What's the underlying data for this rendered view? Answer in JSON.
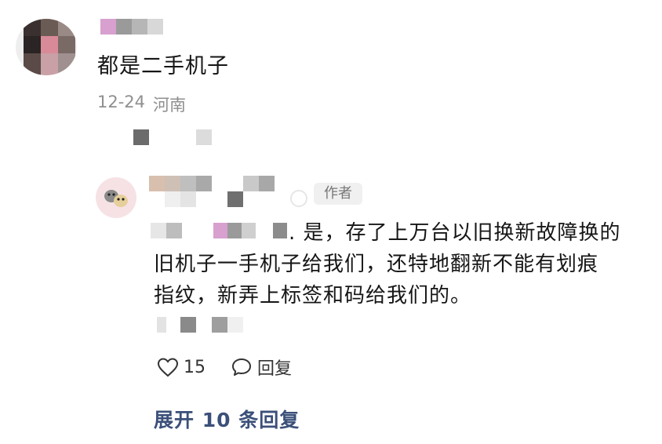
{
  "comment": {
    "text": "都是二手机子",
    "date": "12-24",
    "location": "河南"
  },
  "reply": {
    "badge": "作者",
    "line1_visible": ". 是，存了上万台以旧换新故障换的",
    "line2_visible": "旧机子一手机子给我们，还特地翻新不能有划痕",
    "line3": "指纹，新弄上标签和码给我们的。"
  },
  "actions": {
    "like_icon": "heart-icon",
    "like_count": "15",
    "reply_icon": "comment-bubble-icon",
    "reply_label": "回复"
  },
  "expand_label": "展开 10 条回复",
  "colors": {
    "link": "#3b5079",
    "meta": "#8f8f8f",
    "badge_bg": "#f0f0f0"
  }
}
